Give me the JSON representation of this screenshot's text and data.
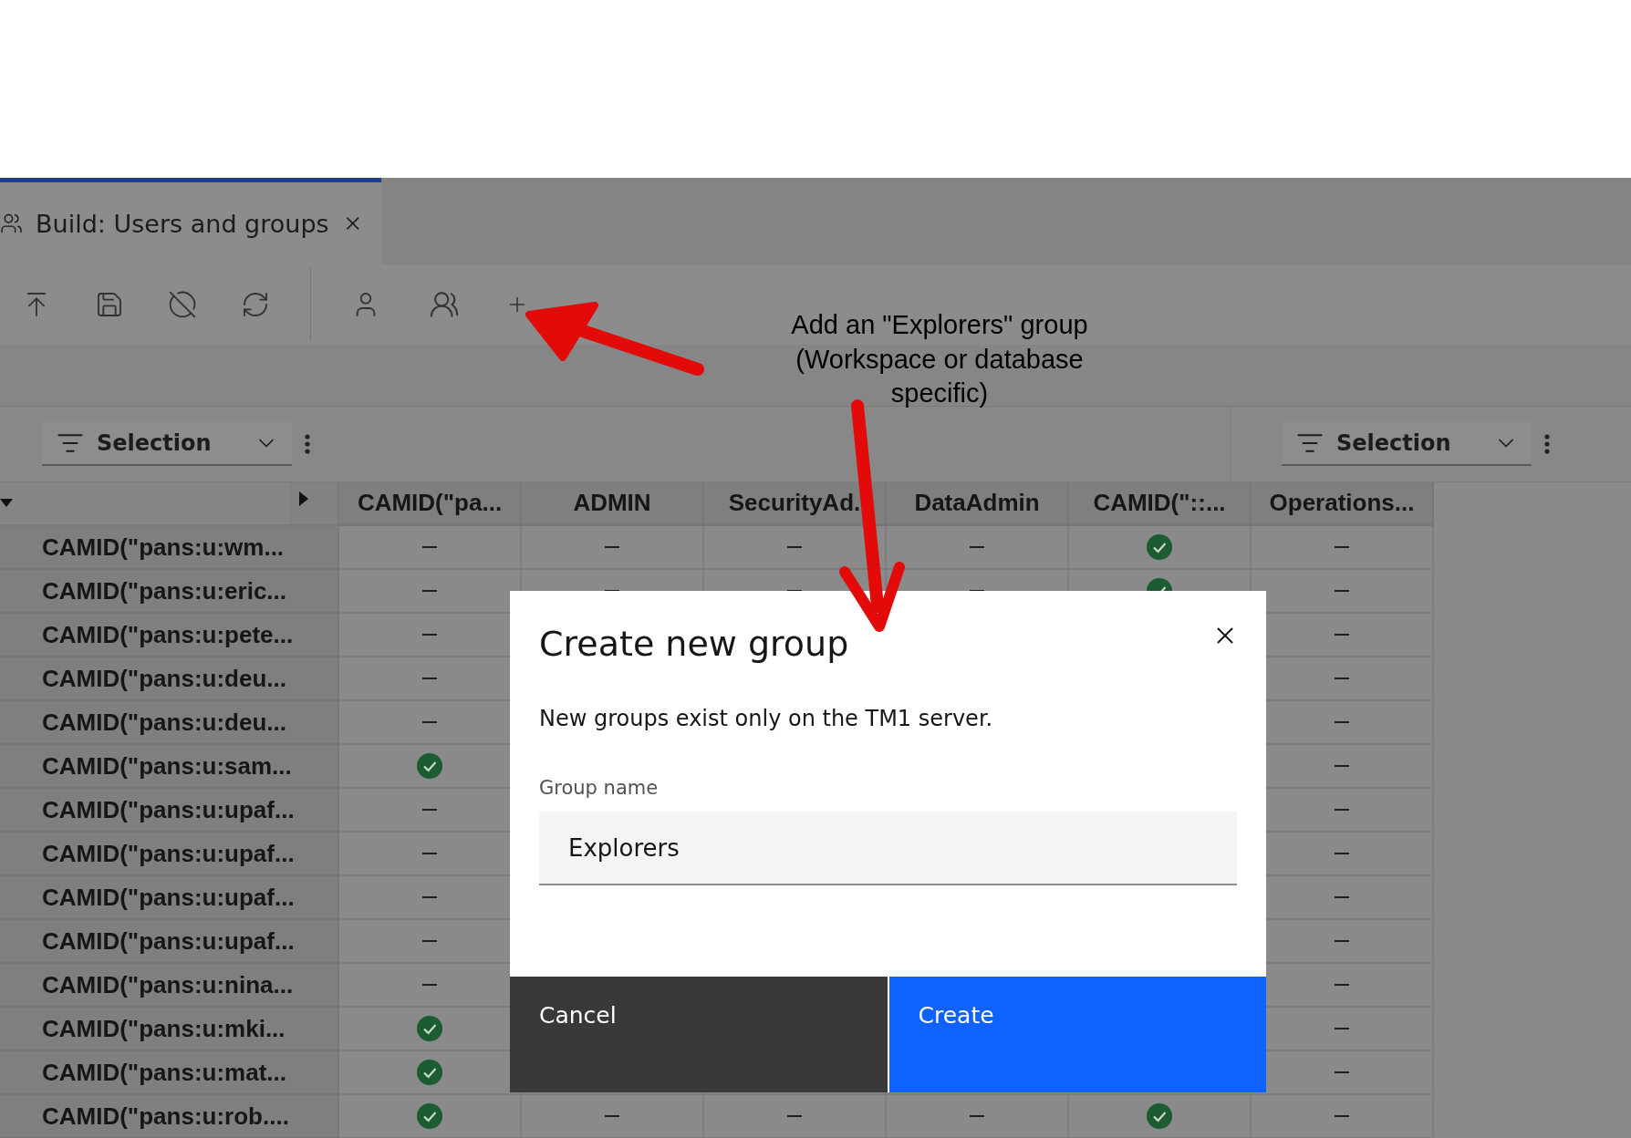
{
  "tab": {
    "title": "Build: Users and groups",
    "selected": true
  },
  "selectors": [
    {
      "label": "Selection"
    },
    {
      "label": "Selection"
    }
  ],
  "table": {
    "columns": [
      "CAMID(\"pa...",
      "ADMIN",
      "SecurityAd.",
      "DataAdmin",
      "CAMID(\"::...",
      "Operations..."
    ],
    "rows": [
      {
        "header": "CAMID(\"pans:u:wm...",
        "cells": [
          false,
          false,
          false,
          false,
          true,
          false
        ]
      },
      {
        "header": "CAMID(\"pans:u:eric...",
        "cells": [
          false,
          false,
          false,
          false,
          true,
          false
        ]
      },
      {
        "header": "CAMID(\"pans:u:pete...",
        "cells": [
          false,
          null,
          null,
          null,
          null,
          false
        ]
      },
      {
        "header": "CAMID(\"pans:u:deu...",
        "cells": [
          false,
          null,
          null,
          null,
          null,
          false
        ]
      },
      {
        "header": "CAMID(\"pans:u:deu...",
        "cells": [
          false,
          null,
          null,
          null,
          null,
          false
        ]
      },
      {
        "header": "CAMID(\"pans:u:sam...",
        "cells": [
          true,
          null,
          null,
          null,
          null,
          false
        ]
      },
      {
        "header": "CAMID(\"pans:u:upaf...",
        "cells": [
          false,
          null,
          null,
          null,
          null,
          false
        ]
      },
      {
        "header": "CAMID(\"pans:u:upaf...",
        "cells": [
          false,
          null,
          null,
          null,
          null,
          false
        ]
      },
      {
        "header": "CAMID(\"pans:u:upaf...",
        "cells": [
          false,
          null,
          null,
          null,
          null,
          false
        ]
      },
      {
        "header": "CAMID(\"pans:u:upaf...",
        "cells": [
          false,
          null,
          null,
          null,
          null,
          false
        ]
      },
      {
        "header": "CAMID(\"pans:u:nina...",
        "cells": [
          false,
          null,
          null,
          null,
          null,
          false
        ]
      },
      {
        "header": "CAMID(\"pans:u:mki...",
        "cells": [
          true,
          null,
          null,
          null,
          null,
          false
        ]
      },
      {
        "header": "CAMID(\"pans:u:mat...",
        "cells": [
          true,
          null,
          null,
          null,
          null,
          false
        ]
      },
      {
        "header": "CAMID(\"pans:u:rob....",
        "cells": [
          true,
          false,
          false,
          false,
          true,
          false
        ]
      }
    ]
  },
  "dialog": {
    "title": "Create new group",
    "description": "New groups exist only on the TM1 server.",
    "field": {
      "label": "Group name",
      "value": "Explorers"
    },
    "buttons": [
      {
        "label": "Cancel",
        "kind": "secondary"
      },
      {
        "label": "Create",
        "kind": "primary"
      }
    ]
  },
  "annotation": {
    "text": "Add an \"Explorers\" group (Workspace or database specific)"
  }
}
